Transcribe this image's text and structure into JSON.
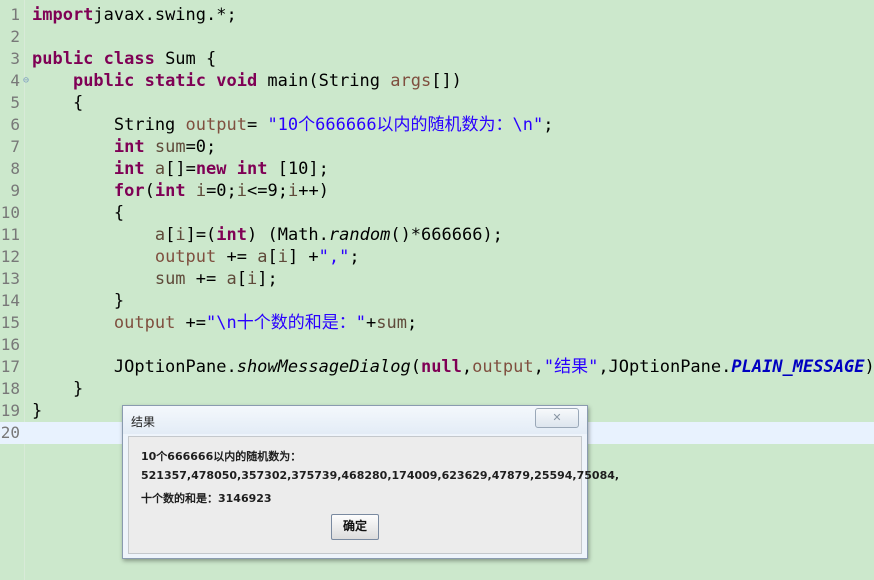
{
  "editor": {
    "lines": [
      {
        "num": "1",
        "parts": [
          [
            "kw",
            "import"
          ],
          [
            "",
            "javax.swing.*;"
          ]
        ]
      },
      {
        "num": "2",
        "parts": []
      },
      {
        "num": "3",
        "parts": [
          [
            "kw",
            "public class "
          ],
          [
            "",
            "Sum {"
          ]
        ]
      },
      {
        "num": "4",
        "fold": "⊖",
        "parts": [
          [
            "",
            "    "
          ],
          [
            "kw",
            "public static void "
          ],
          [
            "",
            "main(String "
          ],
          [
            "fld",
            "args"
          ],
          [
            "",
            "[])"
          ]
        ]
      },
      {
        "num": "5",
        "parts": [
          [
            "",
            "    {"
          ]
        ]
      },
      {
        "num": "6",
        "parts": [
          [
            "",
            "        String "
          ],
          [
            "fld",
            "output"
          ],
          [
            "",
            "= "
          ],
          [
            "str",
            "\"10个666666以内的随机数为：\\n\""
          ],
          [
            "",
            ";"
          ]
        ]
      },
      {
        "num": "7",
        "parts": [
          [
            "",
            "        "
          ],
          [
            "kw",
            "int "
          ],
          [
            "var",
            "sum"
          ],
          [
            "",
            "=0;"
          ]
        ]
      },
      {
        "num": "8",
        "parts": [
          [
            "",
            "        "
          ],
          [
            "kw",
            "int "
          ],
          [
            "var",
            "a"
          ],
          [
            "",
            "[]="
          ],
          [
            "kw",
            "new int "
          ],
          [
            "",
            "[10];"
          ]
        ]
      },
      {
        "num": "9",
        "parts": [
          [
            "",
            "        "
          ],
          [
            "kw",
            "for"
          ],
          [
            "",
            "("
          ],
          [
            "kw",
            "int "
          ],
          [
            "var",
            "i"
          ],
          [
            "",
            "=0;"
          ],
          [
            "var",
            "i"
          ],
          [
            "",
            "<=9;"
          ],
          [
            "var",
            "i"
          ],
          [
            "",
            "++)"
          ]
        ]
      },
      {
        "num": "10",
        "parts": [
          [
            "",
            "        {"
          ]
        ]
      },
      {
        "num": "11",
        "parts": [
          [
            "",
            "            "
          ],
          [
            "var",
            "a"
          ],
          [
            "",
            "["
          ],
          [
            "var",
            "i"
          ],
          [
            "",
            "]=("
          ],
          [
            "kw",
            "int"
          ],
          [
            "",
            ") (Math."
          ],
          [
            "static-m",
            "random"
          ],
          [
            "",
            "()*666666);"
          ]
        ]
      },
      {
        "num": "12",
        "parts": [
          [
            "",
            "            "
          ],
          [
            "fld",
            "output"
          ],
          [
            "",
            " += "
          ],
          [
            "var",
            "a"
          ],
          [
            "",
            "["
          ],
          [
            "var",
            "i"
          ],
          [
            "",
            "] +"
          ],
          [
            "str",
            "\",\""
          ],
          [
            "",
            ";"
          ]
        ]
      },
      {
        "num": "13",
        "parts": [
          [
            "",
            "            "
          ],
          [
            "var",
            "sum"
          ],
          [
            "",
            " += "
          ],
          [
            "var",
            "a"
          ],
          [
            "",
            "["
          ],
          [
            "var",
            "i"
          ],
          [
            "",
            "];"
          ]
        ]
      },
      {
        "num": "14",
        "parts": [
          [
            "",
            "        }"
          ]
        ]
      },
      {
        "num": "15",
        "parts": [
          [
            "",
            "        "
          ],
          [
            "fld",
            "output"
          ],
          [
            "",
            " +="
          ],
          [
            "str",
            "\"\\n十个数的和是：\""
          ],
          [
            "",
            "+"
          ],
          [
            "var",
            "sum"
          ],
          [
            "",
            ";"
          ]
        ]
      },
      {
        "num": "16",
        "parts": []
      },
      {
        "num": "17",
        "parts": [
          [
            "",
            "        JOptionPane."
          ],
          [
            "static-m",
            "showMessageDialog"
          ],
          [
            "",
            "("
          ],
          [
            "kw",
            "null"
          ],
          [
            "",
            ","
          ],
          [
            "fld",
            "output"
          ],
          [
            "",
            ","
          ],
          [
            "str",
            "\"结果\""
          ],
          [
            "",
            ",JOptionPane."
          ],
          [
            "const",
            "PLAIN_MESSAGE"
          ],
          [
            "",
            ");"
          ]
        ]
      },
      {
        "num": "18",
        "parts": [
          [
            "",
            "    }"
          ]
        ]
      },
      {
        "num": "19",
        "parts": [
          [
            "",
            "}"
          ]
        ]
      },
      {
        "num": "20",
        "current": true,
        "parts": []
      }
    ]
  },
  "dialog": {
    "title": "结果",
    "close_glyph": "✕",
    "line1": "10个666666以内的随机数为：",
    "line2": "521357,478050,357302,375739,468280,174009,623629,47879,25594,75084,",
    "line3": "十个数的和是：3146923",
    "ok_label": "确定"
  }
}
